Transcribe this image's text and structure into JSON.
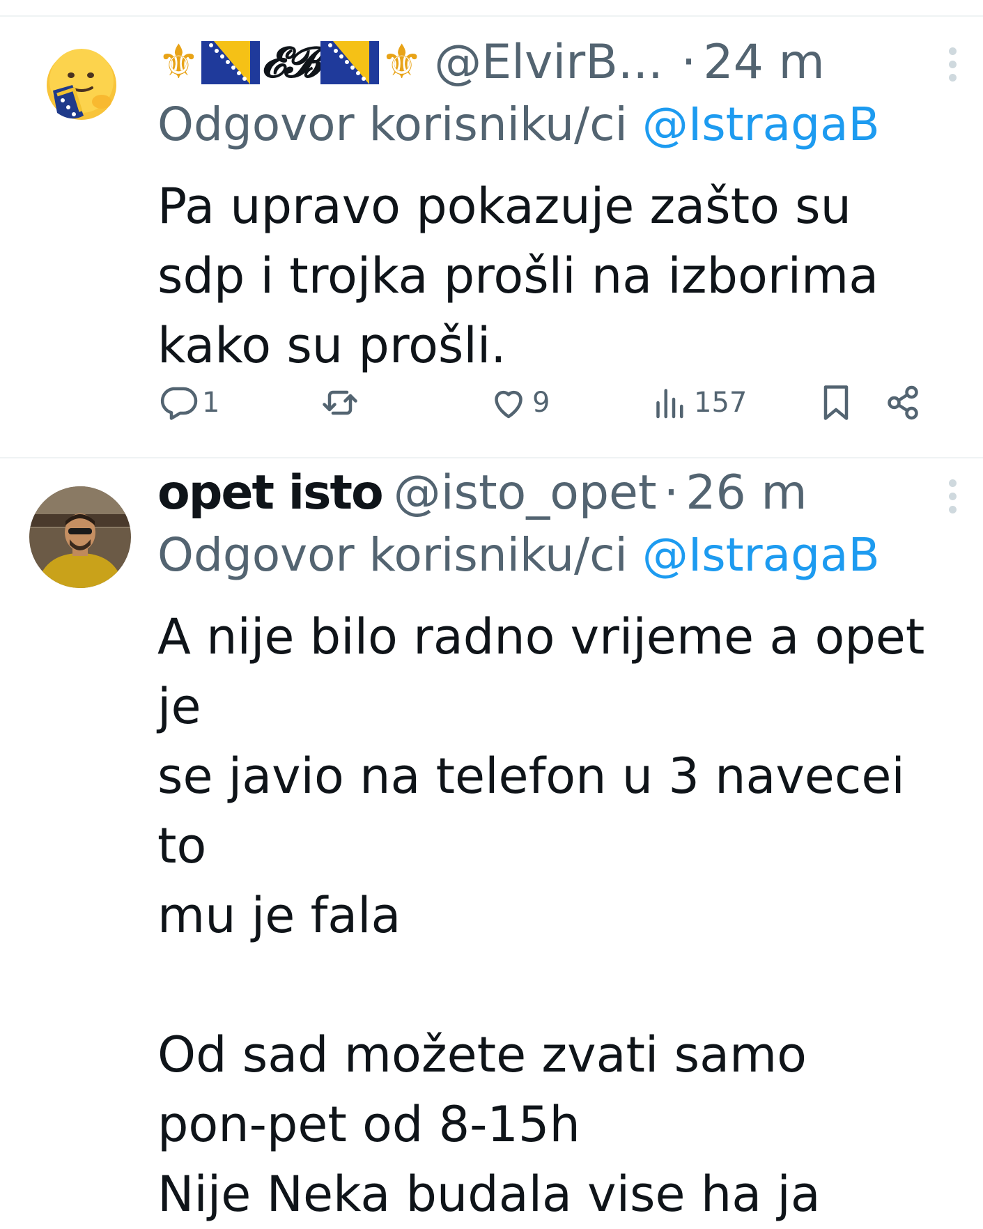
{
  "tweets": [
    {
      "display_name": "⚜️🇧🇦𝓔𝓑🇧🇦⚜️",
      "display_name_text": "𝓔𝓑",
      "handle": "@ElvirB...",
      "separator": "·",
      "time": "24 m",
      "reply_label": "Odgovor korisniku/ci",
      "reply_mention": "@IstragaB",
      "body": "Pa upravo pokazuje zašto su sdp i trojka prošli na izborima kako su prošli.",
      "actions": {
        "replies": "1",
        "reposts": "",
        "likes": "9",
        "views": "157"
      },
      "avatar_icon": "hugging-face-with-bosnian-flag-icon"
    },
    {
      "display_name": "opet isto",
      "handle": "@isto_opet",
      "separator": "·",
      "time": "26 m",
      "reply_label": "Odgovor korisniku/ci",
      "reply_mention": "@IstragaB",
      "body_lines": [
        "A nije bilo radno vrijeme a opet je",
        "se javio na telefon u 3 navecei to",
        "mu je fala",
        "",
        "Od sad možete zvati samo",
        "pon-pet od 8-15h",
        "Nije Neka budala vise ha ja"
      ],
      "avatar_icon": "profile-photo-icon"
    }
  ],
  "colors": {
    "text_primary": "#0f1419",
    "text_secondary": "#536471",
    "link": "#1d9bf0",
    "divider": "#eff3f4"
  }
}
